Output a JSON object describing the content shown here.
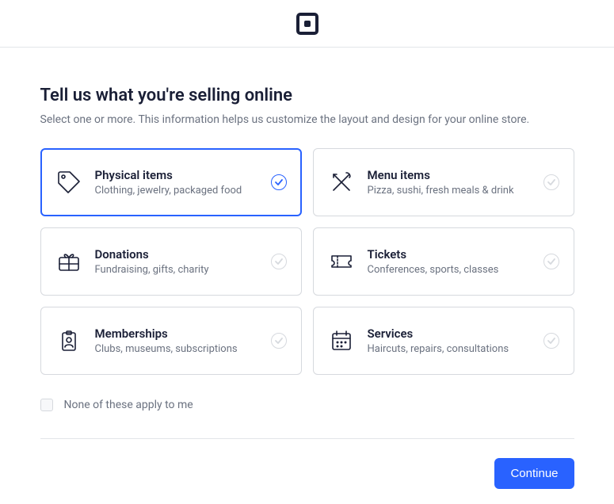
{
  "heading": "Tell us what you're selling online",
  "subtitle": "Select one or more. This information helps us customize the layout and design for your online store.",
  "options": [
    {
      "title": "Physical items",
      "desc": "Clothing, jewelry, packaged food",
      "selected": true
    },
    {
      "title": "Menu items",
      "desc": "Pizza, sushi, fresh meals & drink",
      "selected": false
    },
    {
      "title": "Donations",
      "desc": "Fundraising, gifts, charity",
      "selected": false
    },
    {
      "title": "Tickets",
      "desc": "Conferences, sports, classes",
      "selected": false
    },
    {
      "title": "Memberships",
      "desc": "Clubs, museums, subscriptions",
      "selected": false
    },
    {
      "title": "Services",
      "desc": "Haircuts, repairs, consultations",
      "selected": false
    }
  ],
  "none_label": "None of these apply to me",
  "continue_label": "Continue"
}
